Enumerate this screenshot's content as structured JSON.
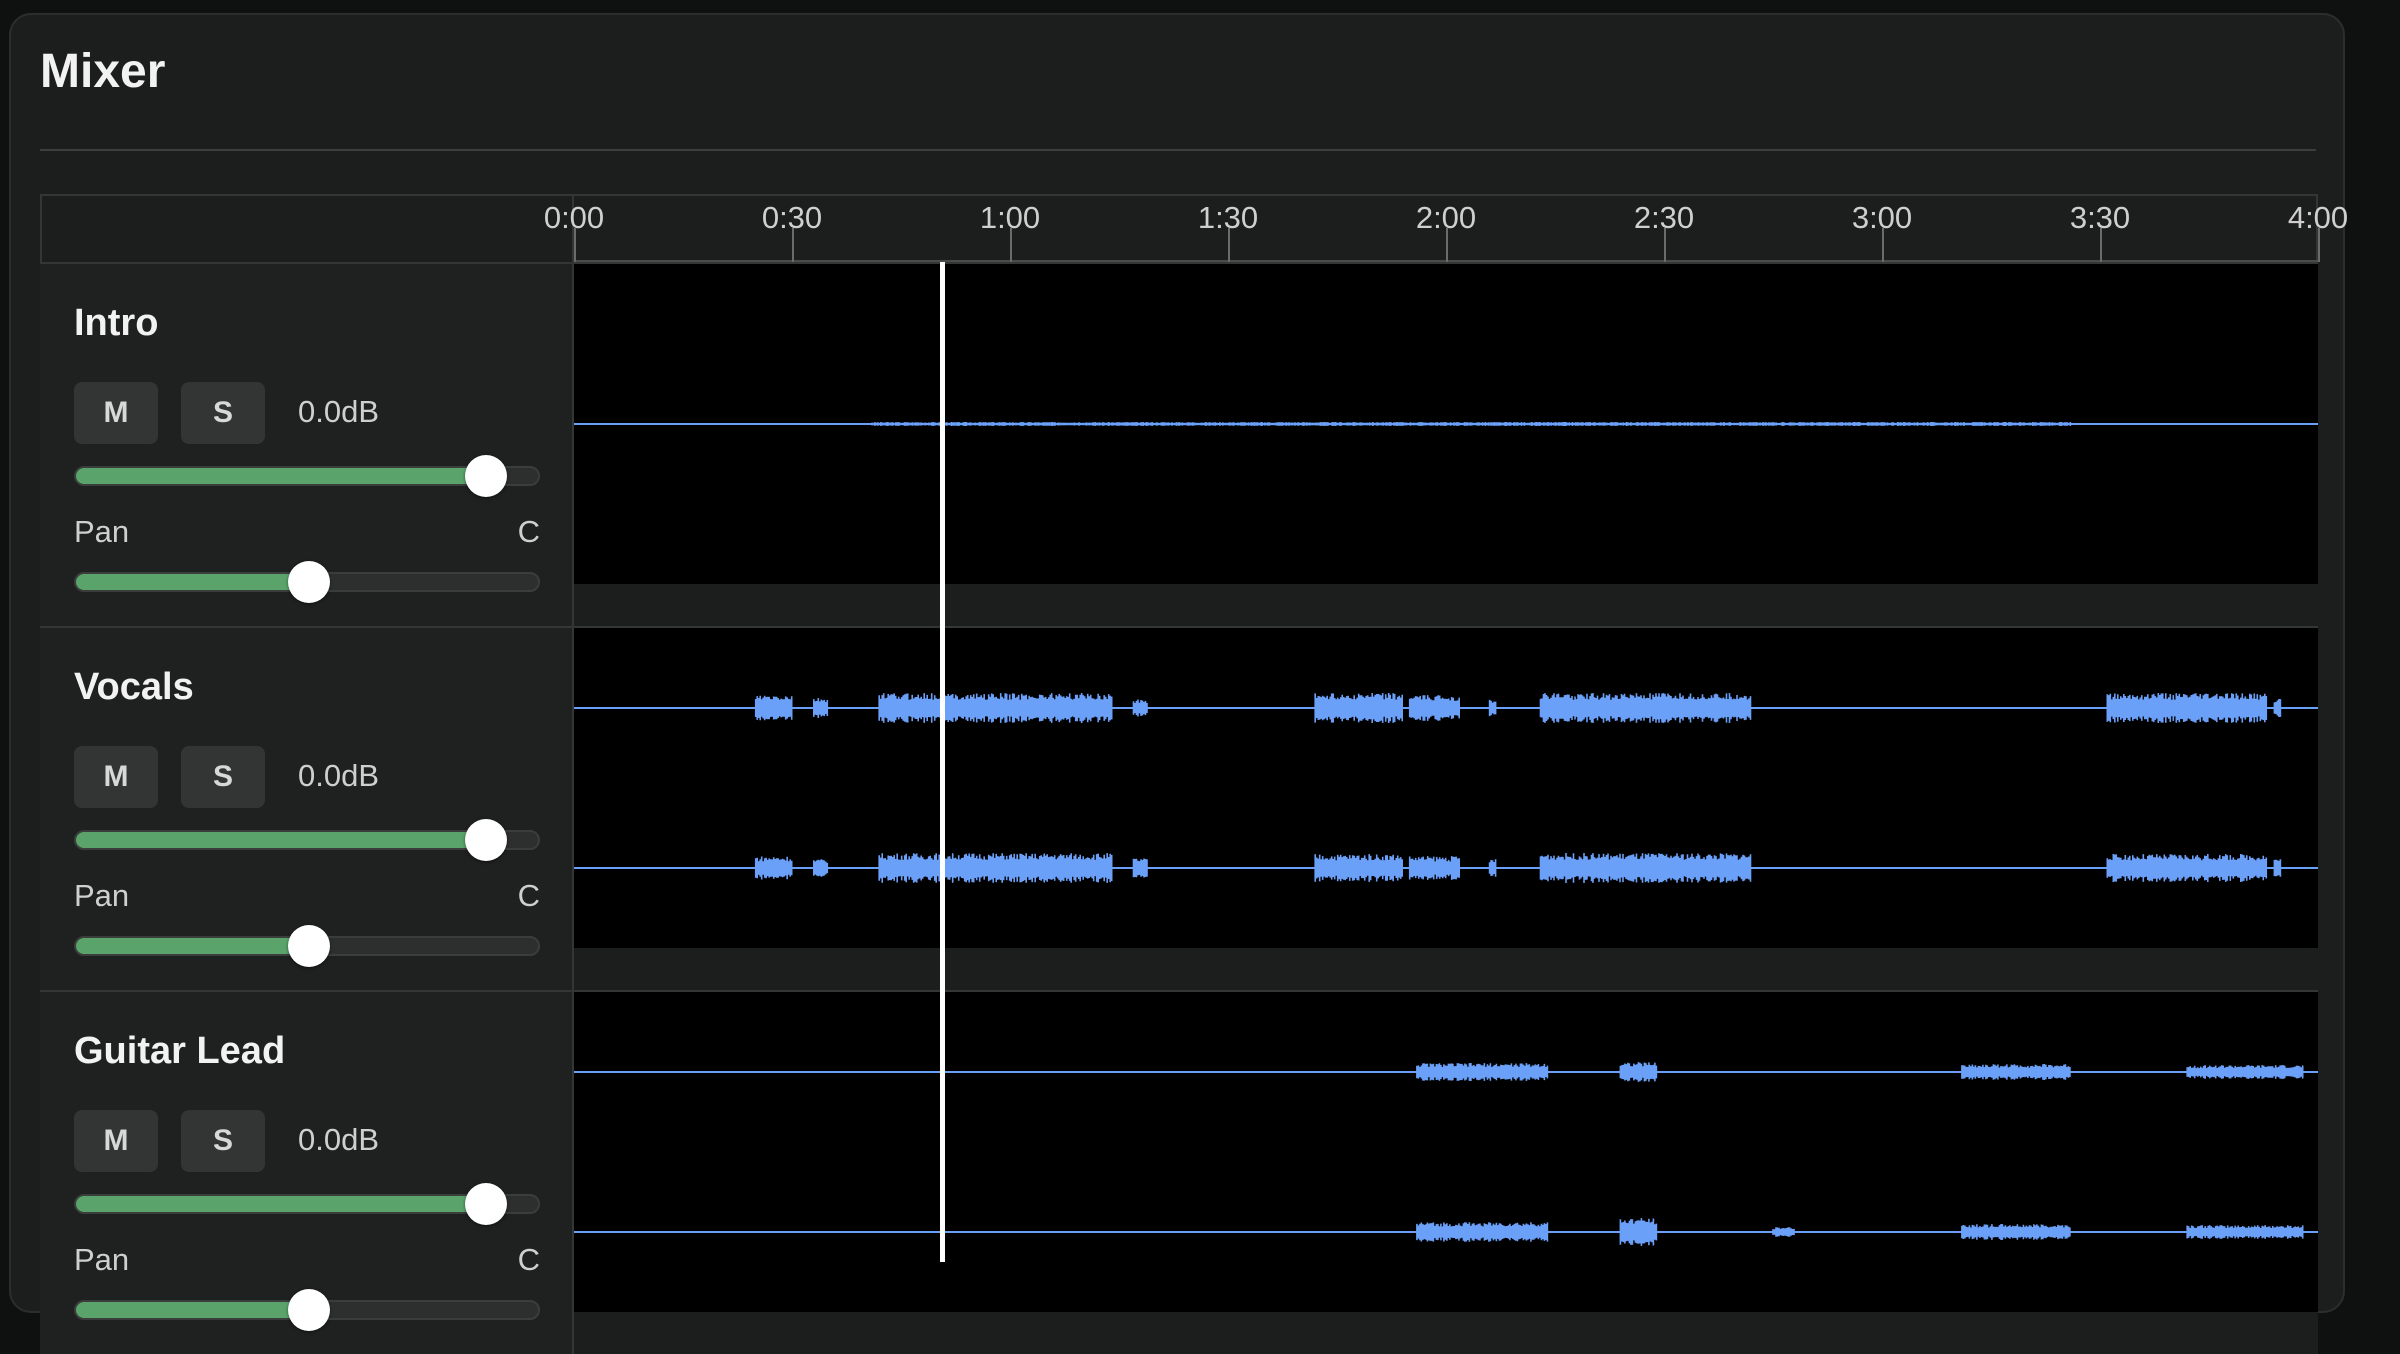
{
  "app": {
    "title": "Mixer"
  },
  "timeline": {
    "labels": [
      "0:00",
      "0:30",
      "1:00",
      "1:30",
      "2:00",
      "2:30",
      "3:00",
      "3:30",
      "4:00"
    ],
    "playhead_time": "0:51"
  },
  "tracks": [
    {
      "name": "Intro",
      "mute_label": "M",
      "solo_label": "S",
      "gain": "0.0dB",
      "gain_level": 0.88,
      "pan_label": "Pan",
      "pan_value": "C",
      "pan_level": 0.5,
      "channels": 1
    },
    {
      "name": "Vocals",
      "mute_label": "M",
      "solo_label": "S",
      "gain": "0.0dB",
      "gain_level": 0.88,
      "pan_label": "Pan",
      "pan_value": "C",
      "pan_level": 0.5,
      "channels": 2
    },
    {
      "name": "Guitar Lead",
      "mute_label": "M",
      "solo_label": "S",
      "gain": "0.0dB",
      "gain_level": 0.88,
      "pan_label": "Pan",
      "pan_value": "C",
      "pan_level": 0.5,
      "channels": 2
    }
  ],
  "colors": {
    "waveform": "#6aa0f8",
    "fader_fill": "#5aa46c",
    "playhead": "#ffffff"
  }
}
